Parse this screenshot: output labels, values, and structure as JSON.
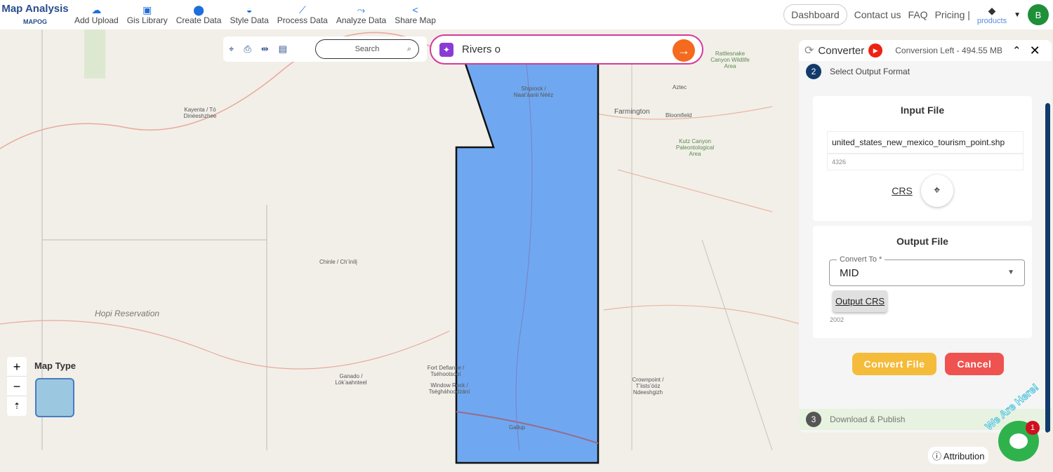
{
  "header": {
    "logo_title": "Map Analysis",
    "logo_sub": "MAPOG",
    "nav": [
      {
        "label": "Add Upload",
        "icon": "cloud-upload-icon"
      },
      {
        "label": "Gis Library",
        "icon": "library-icon"
      },
      {
        "label": "Create Data",
        "icon": "pin-icon"
      },
      {
        "label": "Style Data",
        "icon": "paint-icon"
      },
      {
        "label": "Process Data",
        "icon": "process-icon"
      },
      {
        "label": "Analyze Data",
        "icon": "analyze-icon"
      },
      {
        "label": "Share Map",
        "icon": "share-icon"
      }
    ],
    "dashboard": "Dashboard",
    "contact": "Contact us",
    "faq": "FAQ",
    "pricing": "Pricing |",
    "products": "products",
    "avatar": "B"
  },
  "toolbar": {
    "search_placeholder": "Search",
    "ai_query": "Rivers o"
  },
  "map": {
    "labels": [
      "Kayenta / Tó Dinéeshzhee",
      "Hopi Reservation",
      "Chinle / Chʼínílį",
      "Ganado / Lókʼaahnteel",
      "Fort Defiance / Tséhootsooí",
      "Window Rock / Tségháhoodzání",
      "Shiprock / Naatʼáanii Nééz",
      "Farmington",
      "Aztec",
      "Bloomfield",
      "Gallup",
      "Crownpoint / Tʼiistsʼóóz Ndeeshgizh",
      "Kutz Canyon Paleontological Area",
      "Rattlesnake Canyon Wildlife Area"
    ],
    "map_type": "Map Type",
    "attribution": "Attribution",
    "polygon_color": "#6fa8f0"
  },
  "converter": {
    "title": "Converter",
    "conversion_left": "Conversion Left - 494.55 MB",
    "step2_num": "2",
    "step2_label": "Select Output Format",
    "input_title": "Input File",
    "input_file": "united_states_new_mexico_tourism_point.shp",
    "input_crs": "4326",
    "crs_label": "CRS",
    "output_title": "Output File",
    "convert_to_label": "Convert To *",
    "convert_to_value": "MID",
    "output_crs_button": "Output CRS",
    "output_crs": "2002",
    "convert_button": "Convert File",
    "cancel_button": "Cancel",
    "step3_num": "3",
    "step3_label": "Download & Publish"
  },
  "chat": {
    "badge": "1",
    "tagline": "We Are Here!"
  }
}
